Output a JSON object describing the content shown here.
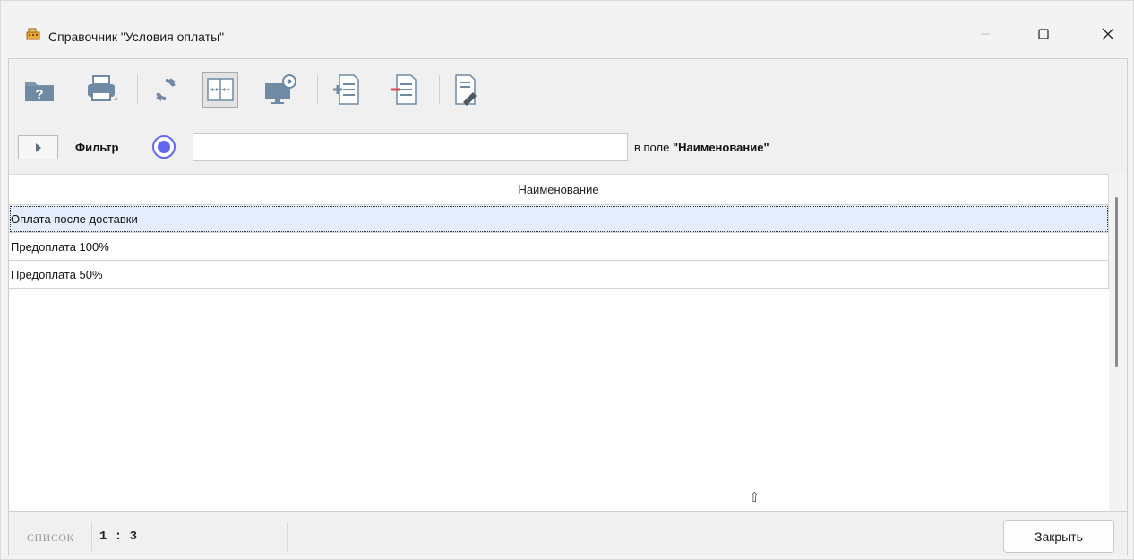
{
  "window": {
    "title": "Справочник \"Условия оплаты\"",
    "icon": "cash-register-icon",
    "controls": {
      "minimize": "—",
      "maximize": "☐",
      "close": "✕"
    }
  },
  "toolbar": {
    "buttons": [
      {
        "name": "help-button",
        "icon": "help-folder-icon"
      },
      {
        "name": "print-button",
        "icon": "printer-icon"
      },
      {
        "name": "refresh-button",
        "icon": "refresh-icon"
      },
      {
        "name": "fit-columns-button",
        "icon": "fit-columns-icon",
        "pressed": true
      },
      {
        "name": "settings-button",
        "icon": "monitor-gear-icon"
      },
      {
        "name": "add-record-button",
        "icon": "add-record-icon"
      },
      {
        "name": "delete-record-button",
        "icon": "delete-record-icon"
      },
      {
        "name": "edit-record-button",
        "icon": "edit-record-icon"
      }
    ]
  },
  "filter": {
    "label": "Фильтр",
    "value": "",
    "placeholder": "",
    "caption_prefix": "в поле ",
    "caption_field": "\"Наименование\""
  },
  "grid": {
    "column_header": "Наименование",
    "rows": [
      {
        "name": "Оплата после доставки",
        "selected": true
      },
      {
        "name": "Предоплата 100%",
        "selected": false
      },
      {
        "name": "Предоплата 50%",
        "selected": false
      }
    ]
  },
  "status": {
    "mode_label": "СПИСОК",
    "position": "1 : 3"
  },
  "footer": {
    "close_label": "Закрыть"
  },
  "colors": {
    "accent": "#6366f1",
    "selection": "#e5ecfb"
  }
}
